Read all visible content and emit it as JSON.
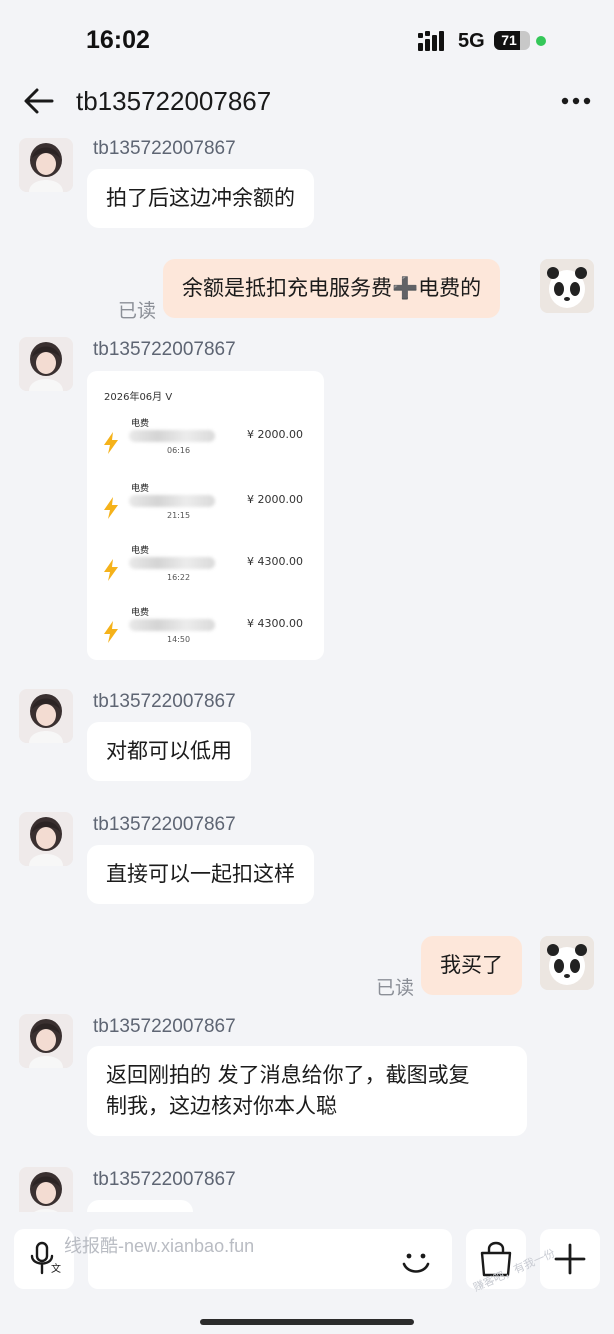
{
  "status_bar": {
    "time": "16:02",
    "network": "5G",
    "battery_level": "71",
    "battery_fraction": 0.71
  },
  "header": {
    "title": "tb135722007867",
    "back_icon": "arrow-left-icon",
    "more_icon": "more-horizontal-icon"
  },
  "messages": {
    "m1": {
      "sender": "tb135722007867",
      "text": "拍了后这边冲余额的"
    },
    "m2": {
      "text": "余额是抵扣充电服务费➕电费的",
      "read": "已读"
    },
    "m3": {
      "sender": "tb135722007867",
      "card": {
        "month": "2026年06月 V",
        "rows": [
          {
            "name": "电费",
            "time": "06:16",
            "amount": "¥ 2000.00"
          },
          {
            "name": "电费",
            "time": "21:15",
            "amount": "¥ 2000.00"
          },
          {
            "name": "电费",
            "time": "16:22",
            "amount": "¥ 4300.00"
          },
          {
            "name": "电费",
            "time": "14:50",
            "amount": "¥ 4300.00"
          }
        ]
      }
    },
    "m4": {
      "sender": "tb135722007867",
      "text": "对都可以低用"
    },
    "m5": {
      "sender": "tb135722007867",
      "text": "直接可以一起扣这样"
    },
    "m6": {
      "text": "我买了",
      "read": "已读"
    },
    "m7": {
      "sender": "tb135722007867",
      "text_line1": "返回刚拍的 发了消息给你了，截图或复",
      "text_line2": "制我，这边核对你本人聪"
    },
    "m8": {
      "sender": "tb135722007867"
    }
  },
  "input_bar": {
    "watermark": "线报酷-new.xianbao.fun",
    "corner_watermark": "赚客吧，有我一份",
    "icons": [
      "mic-translate-icon",
      "smile-icon",
      "shopping-bag-icon",
      "plus-icon"
    ]
  },
  "colors": {
    "background": "#f3f4f7",
    "incoming_bubble": "#ffffff",
    "outgoing_bubble": "#fde7da",
    "bolt": "#f5b21a"
  }
}
